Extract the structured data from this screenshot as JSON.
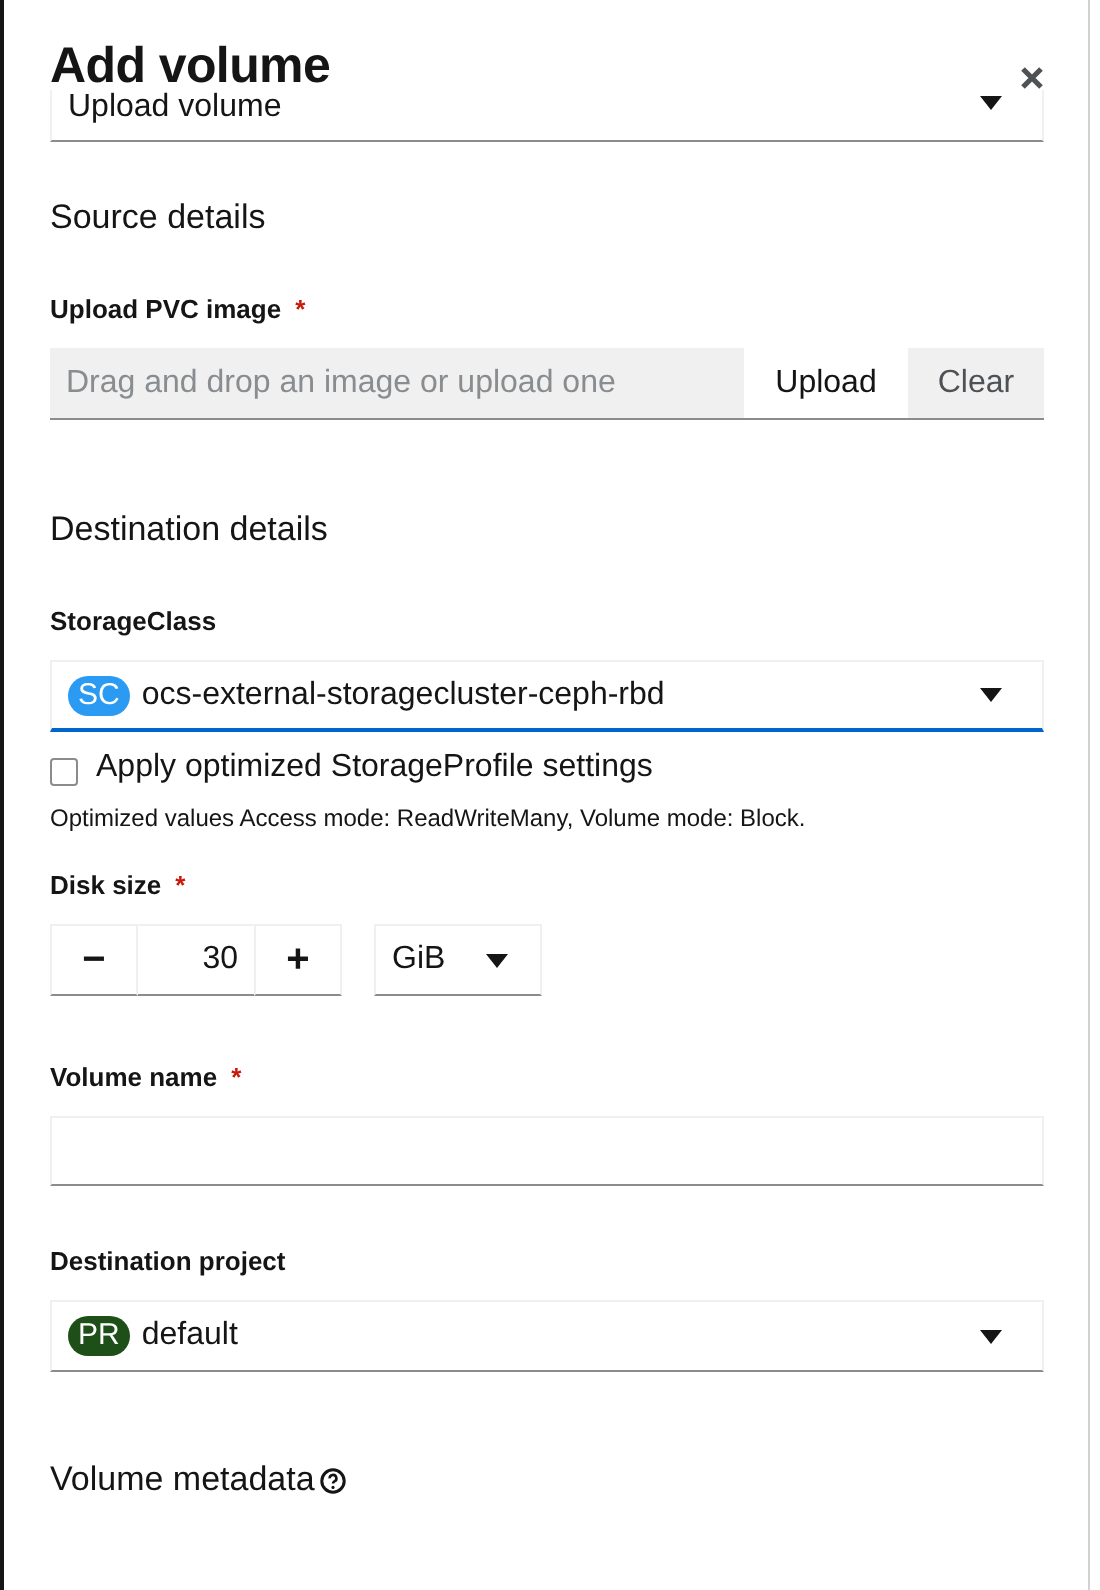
{
  "modal": {
    "title": "Add volume"
  },
  "source_type": {
    "value": "Upload volume"
  },
  "source_details": {
    "heading": "Source details",
    "upload": {
      "label": "Upload PVC image",
      "required_mark": "*",
      "placeholder": "Drag and drop an image or upload one",
      "buttons": [
        "Upload",
        "Clear"
      ]
    }
  },
  "destination_details": {
    "heading": "Destination details",
    "storage_class": {
      "label": "StorageClass",
      "badge": "SC",
      "color": "#2b9af3",
      "value": "ocs-external-storagecluster-ceph-rbd",
      "focused": true
    },
    "optimize": {
      "label": "Apply optimized StorageProfile settings",
      "checked": false,
      "helper": "Optimized values Access mode: ReadWriteMany, Volume mode: Block."
    },
    "disk_size": {
      "label": "Disk size",
      "required_mark": "*",
      "minus": "−",
      "value": "30",
      "plus": "+",
      "unit": "GiB"
    },
    "volume_name": {
      "label": "Volume name",
      "required_mark": "*"
    },
    "project": {
      "label": "Destination project",
      "badge": "PR",
      "color": "#1e4f18",
      "value": "default",
      "focused": false
    }
  },
  "metadata": {
    "heading": "Volume metadata"
  }
}
